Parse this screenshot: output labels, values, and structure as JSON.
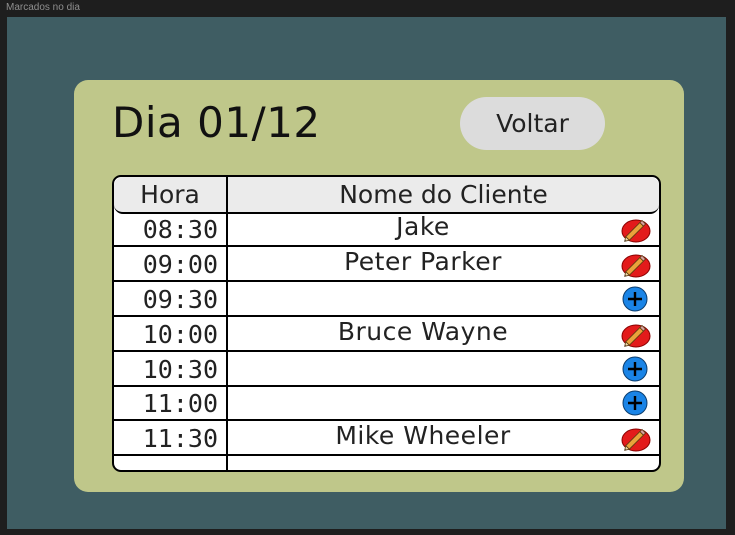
{
  "frame": {
    "label": "Marcados no dia"
  },
  "header": {
    "title": "Dia 01/12",
    "back_label": "Voltar"
  },
  "table": {
    "columns": [
      "Hora",
      "Nome do Cliente"
    ],
    "rows": [
      {
        "time": "08:30",
        "client": "Jake",
        "action": "edit-icon"
      },
      {
        "time": "09:00",
        "client": "Peter Parker",
        "action": "edit-icon"
      },
      {
        "time": "09:30",
        "client": "",
        "action": "add-icon"
      },
      {
        "time": "10:00",
        "client": "Bruce Wayne",
        "action": "edit-icon"
      },
      {
        "time": "10:30",
        "client": "",
        "action": "add-icon"
      },
      {
        "time": "11:00",
        "client": "",
        "action": "add-icon"
      },
      {
        "time": "11:30",
        "client": "Mike Wheeler",
        "action": "edit-icon"
      }
    ]
  },
  "colors": {
    "background": "#3f5d63",
    "card": "#bfc78a",
    "edit": "#e31b1b",
    "add": "#1a84e6"
  }
}
